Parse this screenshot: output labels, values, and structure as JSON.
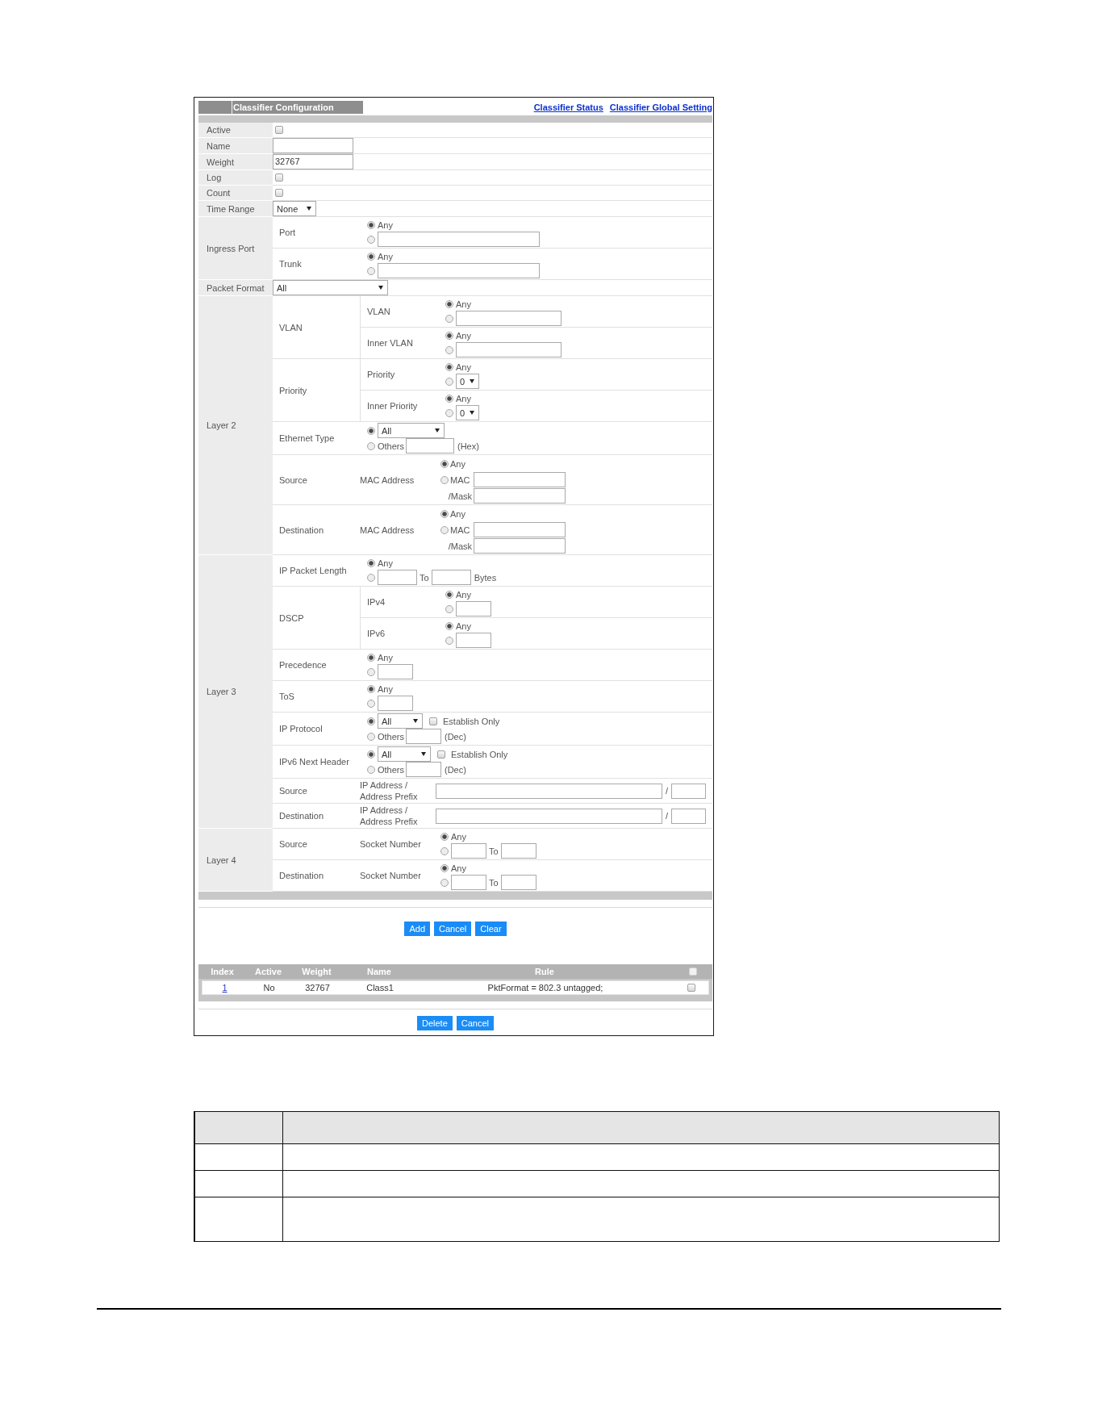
{
  "header": {
    "title": "Classifier Configuration",
    "links": [
      "Classifier Status",
      "Classifier Global Setting"
    ]
  },
  "form": [
    {
      "kind": "checkbox",
      "label": "Active",
      "checked": false
    },
    {
      "kind": "text",
      "label": "Name"
    },
    {
      "kind": "text",
      "label": "Weight",
      "value": "32767"
    },
    {
      "kind": "checkbox",
      "label": "Log",
      "checked": false
    },
    {
      "kind": "checkbox",
      "label": "Count",
      "checked": false
    },
    {
      "kind": "select",
      "label": "Time Range",
      "value": "None"
    },
    {
      "kind": "section",
      "label": "Ingress Port",
      "rows": [
        {
          "label": "Port",
          "control": {
            "kind": "any-or-list",
            "options": [
              {
                "label": "Any",
                "selected": true
              },
              {
                "selected": false
              }
            ]
          }
        },
        {
          "label": "Trunk",
          "control": {
            "kind": "any-or-list",
            "options": [
              {
                "label": "Any",
                "selected": true
              },
              {
                "selected": false
              }
            ]
          }
        }
      ]
    },
    {
      "kind": "select",
      "label": "Packet Format",
      "value": "All"
    },
    {
      "kind": "section",
      "label": "Layer 2",
      "rows": [
        {
          "label": "VLAN",
          "rows": [
            {
              "label": "VLAN",
              "control": {
                "kind": "any-or-id",
                "options": [
                  {
                    "label": "Any",
                    "selected": true
                  },
                  {
                    "selected": false
                  }
                ]
              }
            },
            {
              "label": "Inner VLAN",
              "control": {
                "kind": "any-or-id",
                "options": [
                  {
                    "label": "Any",
                    "selected": true
                  },
                  {
                    "selected": false
                  }
                ]
              }
            }
          ]
        },
        {
          "label": "Priority",
          "rows": [
            {
              "label": "Priority",
              "control": {
                "kind": "any-or-select",
                "options": [
                  {
                    "label": "Any",
                    "selected": true
                  },
                  {
                    "selected": false,
                    "value": "0"
                  }
                ]
              }
            },
            {
              "label": "Inner Priority",
              "control": {
                "kind": "any-or-select",
                "options": [
                  {
                    "label": "Any",
                    "selected": true
                  },
                  {
                    "selected": false,
                    "value": "0"
                  }
                ]
              }
            }
          ]
        },
        {
          "label": "Ethernet Type",
          "control": {
            "kind": "select-or-other",
            "options": [
              {
                "selected": true,
                "value": "All"
              },
              {
                "selected": false,
                "label": "Others",
                "unit": "(Hex)"
              }
            ]
          }
        },
        {
          "label": "Source",
          "sublabel": "MAC Address",
          "control": {
            "kind": "any-or-mac",
            "options": [
              {
                "label": "Any",
                "selected": true
              },
              {
                "label": "MAC",
                "selected": false
              }
            ],
            "mask_label": "/Mask"
          }
        },
        {
          "label": "Destination",
          "sublabel": "MAC Address",
          "control": {
            "kind": "any-or-mac",
            "options": [
              {
                "label": "Any",
                "selected": true
              },
              {
                "label": "MAC",
                "selected": false
              }
            ],
            "mask_label": "/Mask"
          }
        }
      ]
    },
    {
      "kind": "section",
      "label": "Layer 3",
      "rows": [
        {
          "label": "IP Packet Length",
          "control": {
            "kind": "any-or-range",
            "options": [
              {
                "label": "Any",
                "selected": true
              },
              {
                "selected": false,
                "to": "To",
                "unit": "Bytes"
              }
            ]
          }
        },
        {
          "label": "DSCP",
          "rows": [
            {
              "label": "IPv4",
              "control": {
                "kind": "any-or-number",
                "options": [
                  {
                    "label": "Any",
                    "selected": true
                  },
                  {
                    "selected": false
                  }
                ]
              }
            },
            {
              "label": "IPv6",
              "control": {
                "kind": "any-or-number",
                "options": [
                  {
                    "label": "Any",
                    "selected": true
                  },
                  {
                    "selected": false
                  }
                ]
              }
            }
          ]
        },
        {
          "label": "Precedence",
          "control": {
            "kind": "any-or-number",
            "options": [
              {
                "label": "Any",
                "selected": true
              },
              {
                "selected": false
              }
            ]
          }
        },
        {
          "label": "ToS",
          "control": {
            "kind": "any-or-number",
            "options": [
              {
                "label": "Any",
                "selected": true
              },
              {
                "selected": false
              }
            ]
          }
        },
        {
          "label": "IP Protocol",
          "control": {
            "kind": "select-or-other",
            "options": [
              {
                "selected": true,
                "value": "All",
                "checkbox": {
                  "label": "Establish Only",
                  "checked": false
                }
              },
              {
                "selected": false,
                "label": "Others",
                "unit": "(Dec)"
              }
            ]
          }
        },
        {
          "label": "IPv6 Next Header",
          "control": {
            "kind": "select-or-other",
            "options": [
              {
                "selected": true,
                "value": "All",
                "checkbox": {
                  "label": "Establish Only",
                  "checked": false
                }
              },
              {
                "selected": false,
                "label": "Others",
                "unit": "(Dec)"
              }
            ]
          }
        },
        {
          "label": "Source",
          "sublabel": "IP Address / Address Prefix",
          "control": {
            "kind": "address-prefix",
            "separator": "/"
          }
        },
        {
          "label": "Destination",
          "sublabel": "IP Address / Address Prefix",
          "control": {
            "kind": "address-prefix",
            "separator": "/"
          }
        }
      ]
    },
    {
      "kind": "section",
      "label": "Layer 4",
      "rows": [
        {
          "label": "Source",
          "sublabel": "Socket Number",
          "control": {
            "kind": "any-or-range",
            "options": [
              {
                "label": "Any",
                "selected": true
              },
              {
                "selected": false,
                "to": "To"
              }
            ]
          }
        },
        {
          "label": "Destination",
          "sublabel": "Socket Number",
          "control": {
            "kind": "any-or-range",
            "options": [
              {
                "label": "Any",
                "selected": true
              },
              {
                "selected": false,
                "to": "To"
              }
            ]
          }
        }
      ]
    }
  ],
  "form_buttons": [
    "Add",
    "Cancel",
    "Clear"
  ],
  "rules_table": {
    "columns": [
      "Index",
      "Active",
      "Weight",
      "Name",
      "Rule"
    ],
    "select_all": {
      "checked": false
    },
    "rows": [
      {
        "index": "1",
        "active": "No",
        "weight": "32767",
        "name": "Class1",
        "rule": "PktFormat = 802.3 untagged;",
        "checked": false
      }
    ]
  },
  "table_buttons": [
    "Delete",
    "Cancel"
  ],
  "description_table": {
    "rows": [
      {
        "kind": "header"
      },
      {
        "kind": "single"
      },
      {
        "kind": "single"
      },
      {
        "kind": "double"
      }
    ]
  }
}
